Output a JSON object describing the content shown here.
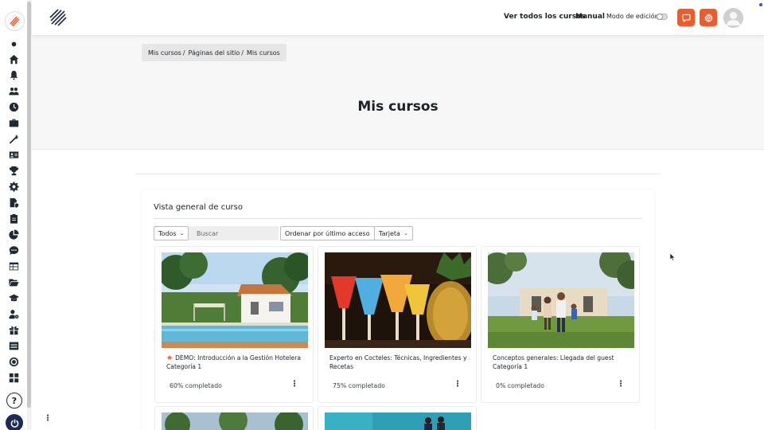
{
  "navbar": {
    "link_all_courses": "Ver todos los cursos",
    "link_manual": "Manual",
    "edit_mode_label": "Modo de edición"
  },
  "breadcrumb": [
    "Mis cursos",
    "Páginas del sitio",
    "Mis cursos"
  ],
  "page": {
    "title": "Mis cursos"
  },
  "overview": {
    "title": "Vista general de curso",
    "filter_label": "Todos",
    "search_placeholder": "Buscar",
    "sort_label": "Ordenar por último acceso",
    "view_label": "Tarjeta"
  },
  "courses": [
    {
      "title": "DEMO: Introducción a la Gestión Hotelera",
      "category": "Categoría 1",
      "progress": "60% completado",
      "progress_value": 60,
      "starred": true
    },
    {
      "title": "Experto en Cocteles: Técnicas, Ingredientes y ...",
      "category": "Recetas",
      "progress": "75% completado",
      "progress_value": 75,
      "starred": false
    },
    {
      "title": "Conceptos generales: Llegada del guest",
      "category": "Categoría 1",
      "progress": "0% completado",
      "progress_value": 0,
      "starred": false
    }
  ],
  "icons": {
    "sidebar": [
      "dot-icon",
      "home-icon",
      "bell-icon",
      "users-icon",
      "clock-icon",
      "briefcase-icon",
      "magic-wand-icon",
      "id-card-icon",
      "trophy-icon",
      "gear-icon",
      "file-shield-icon",
      "clipboard-icon",
      "pie-chart-icon",
      "chat-icon",
      "calendar-table-icon",
      "folder-open-icon",
      "graduation-cap-icon",
      "user-gear-icon",
      "gift-icon",
      "list-icon",
      "target-icon",
      "grid-icon"
    ]
  },
  "colors": {
    "accent": "#f15a29",
    "power": "#1c2b5a"
  }
}
